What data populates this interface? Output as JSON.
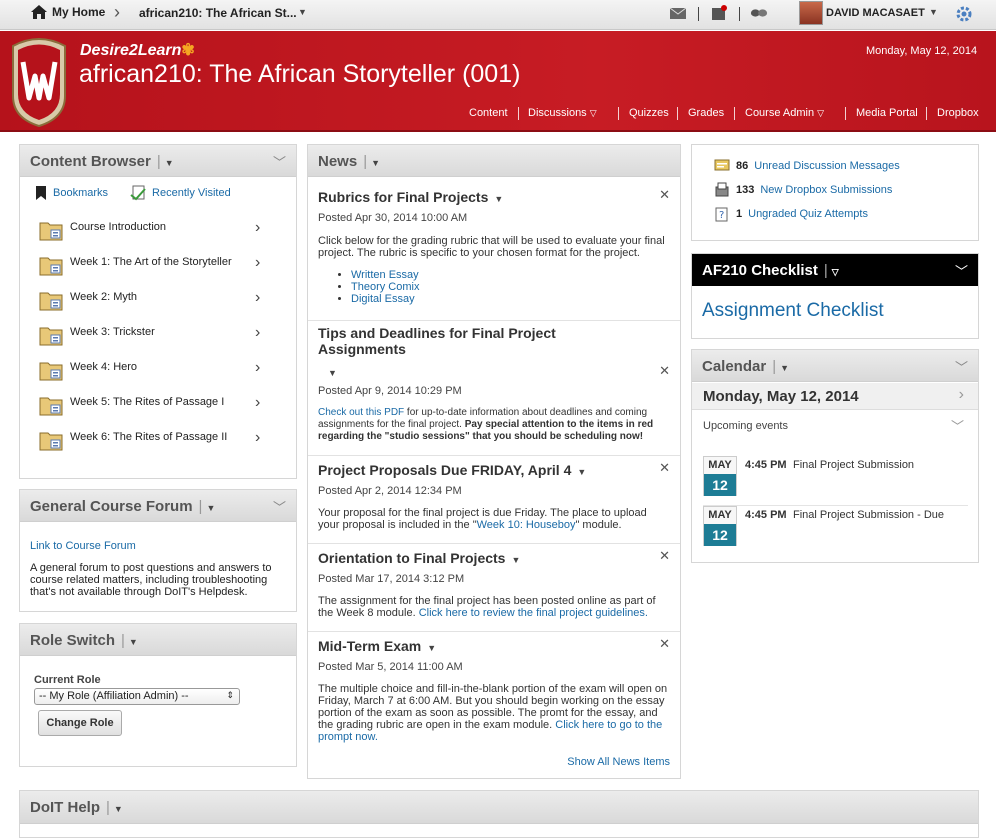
{
  "minibar": {
    "home_label": "My Home",
    "course_selector": "african210: The African St..."
  },
  "user": {
    "name": "DAVID MACASAET"
  },
  "header": {
    "brand": "Desire2Learn",
    "course_title": "african210: The African Storyteller (001)",
    "date": "Monday, May 12, 2014"
  },
  "nav": [
    {
      "label": "Content",
      "dropdown": false
    },
    {
      "label": "Discussions",
      "dropdown": true
    },
    {
      "label": "Quizzes",
      "dropdown": false
    },
    {
      "label": "Grades",
      "dropdown": false
    },
    {
      "label": "Course Admin",
      "dropdown": true
    },
    {
      "label": "Media Portal",
      "dropdown": false
    },
    {
      "label": "Dropbox",
      "dropdown": false
    }
  ],
  "content_browser": {
    "title": "Content Browser",
    "bookmarks": "Bookmarks",
    "recently_visited": "Recently Visited",
    "modules": [
      "Course Introduction",
      "Week 1: The Art of the Storyteller",
      "Week 2: Myth",
      "Week 3: Trickster",
      "Week 4: Hero",
      "Week 5: The Rites of Passage I",
      "Week 6: The Rites of Passage II"
    ]
  },
  "forum": {
    "title": "General Course Forum",
    "link": "Link to Course Forum",
    "description": "A general forum to post questions and answers to course related matters, including troubleshooting that's not available through DoIT's Helpdesk."
  },
  "role_switch": {
    "title": "Role Switch",
    "current_role_label": "Current Role",
    "selected_role": "-- My Role (Affiliation Admin) --",
    "button": "Change Role"
  },
  "news": {
    "title": "News",
    "items": [
      {
        "title": "Rubrics for Final Projects",
        "posted": "Posted Apr 30, 2014 10:00 AM",
        "body": "Click below for the grading rubric that will be used to evaluate your final project. The rubric is specific to your chosen format for the project.",
        "links": [
          "Written Essay",
          "Theory Comix",
          "Digital Essay"
        ]
      },
      {
        "title": "Tips and Deadlines for Final Project Assignments",
        "posted": "Posted Apr 9, 2014 10:29 PM",
        "body_link": "Check out this PDF",
        "body_text": " for up-to-date information about deadlines and coming assignments for the final project. ",
        "body_bold": "Pay special attention to the items in red regarding the \"studio sessions\" that you should be scheduling now!"
      },
      {
        "title": "Project Proposals Due FRIDAY, April 4",
        "posted": "Posted Apr 2, 2014 12:34 PM",
        "body_text": "Your proposal for the final project is due Friday. The place to upload your proposal is included in the \"",
        "body_link": "Week 10: Houseboy",
        "body_end": "\" module."
      },
      {
        "title": "Orientation to Final Projects",
        "posted": "Posted Mar 17, 2014 3:12 PM",
        "body_text": "The assignment for the final project has been posted online as part of the Week 8 module. ",
        "body_link": "Click here to review the final project guidelines."
      },
      {
        "title": "Mid-Term Exam",
        "posted": "Posted Mar 5, 2014 11:00 AM",
        "body_text": "The multiple choice and fill-in-the-blank portion of the exam will open on Friday, March 7 at 6:00 AM. But you should begin working on the essay portion of the exam as soon as possible. The promt for the essay, and the grading rubric are open in the exam module. ",
        "body_link": "Click here to go to the prompt now."
      }
    ],
    "show_all": "Show All News Items"
  },
  "updates": [
    {
      "count": "86",
      "label": "Unread Discussion Messages"
    },
    {
      "count": "133",
      "label": "New Dropbox Submissions"
    },
    {
      "count": "1",
      "label": "Ungraded Quiz Attempts"
    }
  ],
  "checklist": {
    "title": "AF210 Checklist",
    "link": "Assignment Checklist"
  },
  "calendar": {
    "title": "Calendar",
    "date": "Monday, May 12, 2014",
    "upcoming": "Upcoming events",
    "events": [
      {
        "month": "MAY",
        "day": "12",
        "time": "4:45 PM",
        "title": "Final Project Submission"
      },
      {
        "month": "MAY",
        "day": "12",
        "time": "4:45 PM",
        "title": "Final Project Submission - Due"
      }
    ]
  },
  "doit_help": {
    "title": "DoIT Help"
  },
  "colors": {
    "header_red": "#c41a22",
    "link_blue": "#1a6aa6",
    "calendar_teal": "#1d7c95"
  }
}
